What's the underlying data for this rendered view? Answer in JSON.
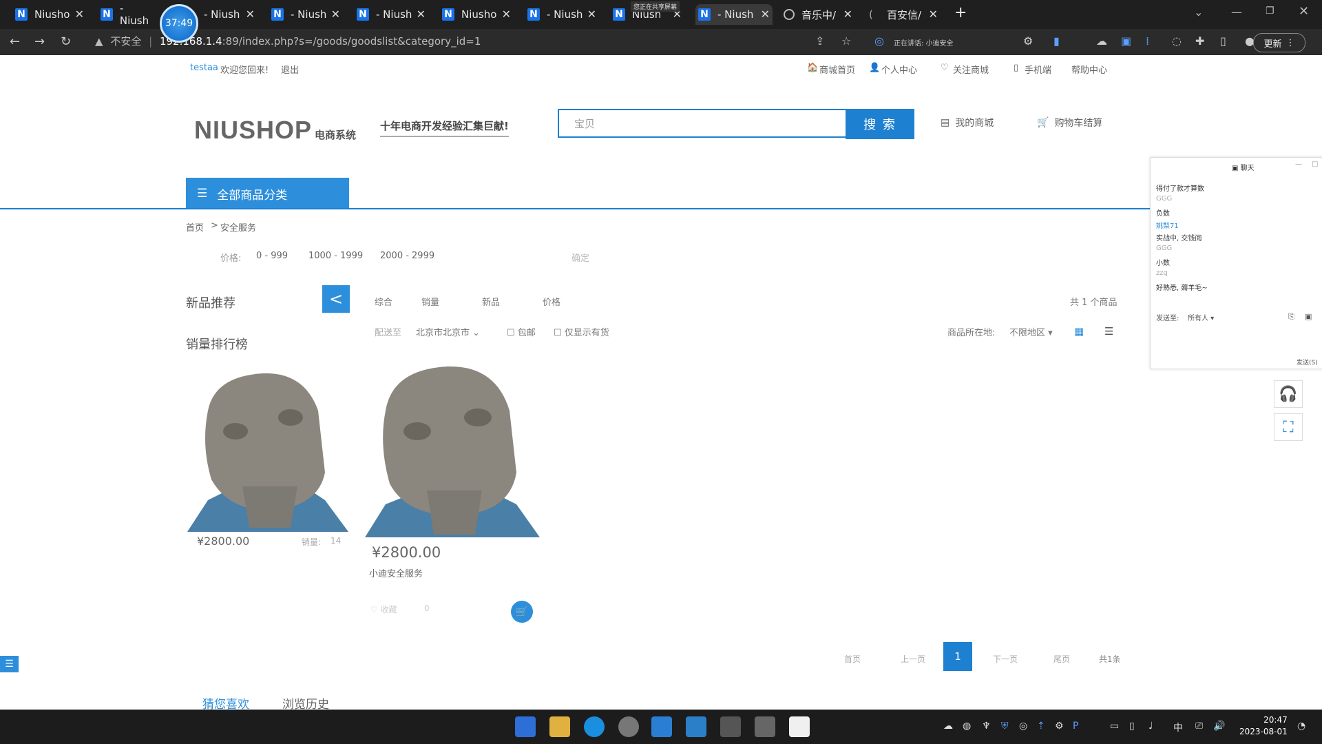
{
  "browser": {
    "tabs": [
      {
        "title": "Niusho",
        "icon": "N"
      },
      {
        "title": "- Niush",
        "icon": "N"
      },
      {
        "title": "- Niush",
        "icon": "N"
      },
      {
        "title": "- Niush",
        "icon": "N"
      },
      {
        "title": "- Niush",
        "icon": "N"
      },
      {
        "title": "Niusho",
        "icon": "N"
      },
      {
        "title": "- Niush",
        "icon": "N"
      },
      {
        "title": "Niush",
        "icon": "N"
      },
      {
        "title": "- Niush",
        "icon": "N"
      },
      {
        "title": "音乐中/",
        "icon": "globe"
      },
      {
        "title": "百安信/",
        "icon": "loading"
      }
    ],
    "close_glyph": "✕",
    "new_tab": "+",
    "timer_bubble": "37:49",
    "sharing_badge": "您正在共享屏幕",
    "security_label": "不安全",
    "url_host": "192.168.1.4",
    "url_path": ":89/index.php?s=/goods/goodslist&category_id=1",
    "speaking_label": "正在讲话: 小迪安全",
    "update_label": "更新"
  },
  "topbar": {
    "username": "testaa",
    "welcome": "欢迎您回来!",
    "logout": "退出",
    "links": [
      "商城首页",
      "个人中心",
      "关注商城",
      "手机端",
      "帮助中心"
    ]
  },
  "header": {
    "logo_main": "NIUSHOP",
    "logo_sub": "电商系统",
    "slogan": "十年电商开发经验汇集巨献!",
    "search_placeholder": "宝贝",
    "search_button": "搜 索",
    "my_mall": "我的商城",
    "cart": "购物车结算"
  },
  "nav": {
    "all_categories": "全部商品分类"
  },
  "breadcrumb": {
    "home": "首页",
    "separator": ">",
    "current": "安全服务"
  },
  "price_filter": {
    "label": "价格:",
    "ranges": [
      "0 - 999",
      "1000 - 1999",
      "2000 - 2999"
    ],
    "confirm": "确定"
  },
  "sidebar": {
    "new_recommend": "新品推荐",
    "sales_rank": "销量排行榜",
    "collapse_glyph": "<"
  },
  "sort": {
    "items": [
      "综合",
      "销量",
      "新品",
      "价格"
    ],
    "total": "共 1 个商品"
  },
  "filters": {
    "ship_to_label": "配送至",
    "ship_to_value": "北京市北京市",
    "free_shipping": "包邮",
    "in_stock_only": "仅显示有货",
    "location_label": "商品所在地:",
    "location_value": "不限地区"
  },
  "products": [
    {
      "price": "¥2800.00",
      "sales_label": "销量:",
      "sales": "14"
    },
    {
      "price": "¥2800.00",
      "name": "小迪安全服务",
      "fav_label": "收藏",
      "fav_count": "0"
    }
  ],
  "pagination": {
    "first": "首页",
    "prev": "上一页",
    "current": "1",
    "next": "下一页",
    "last": "尾页",
    "total": "共1条"
  },
  "bottom_tabs": [
    "猜您喜欢",
    "浏览历史"
  ],
  "chat": {
    "title": "聊天",
    "messages": [
      {
        "text": "得付了款才算数",
        "style": "normal"
      },
      {
        "text": "GGG",
        "style": "gray"
      },
      {
        "text": "负数",
        "style": "normal"
      },
      {
        "text": "姚梨71",
        "style": "blue"
      },
      {
        "text": "实战中, 交钱阅",
        "style": "normal"
      },
      {
        "text": "GGG",
        "style": "gray"
      },
      {
        "text": "小数",
        "style": "normal"
      },
      {
        "text": "zzq",
        "style": "gray"
      },
      {
        "text": "好熟悉, 薅羊毛~",
        "style": "normal"
      }
    ],
    "send_to_label": "发送至:",
    "send_to_value": "所有人",
    "send_button": "发送(S)"
  },
  "taskbar": {
    "ime": "中",
    "time": "20:47",
    "date": "2023-08-01"
  },
  "colors": {
    "accent": "#1e80d0",
    "accent_light": "#2d8fdc",
    "taskbar": "#1c1c1c",
    "chrome": "#1f1f1f"
  }
}
